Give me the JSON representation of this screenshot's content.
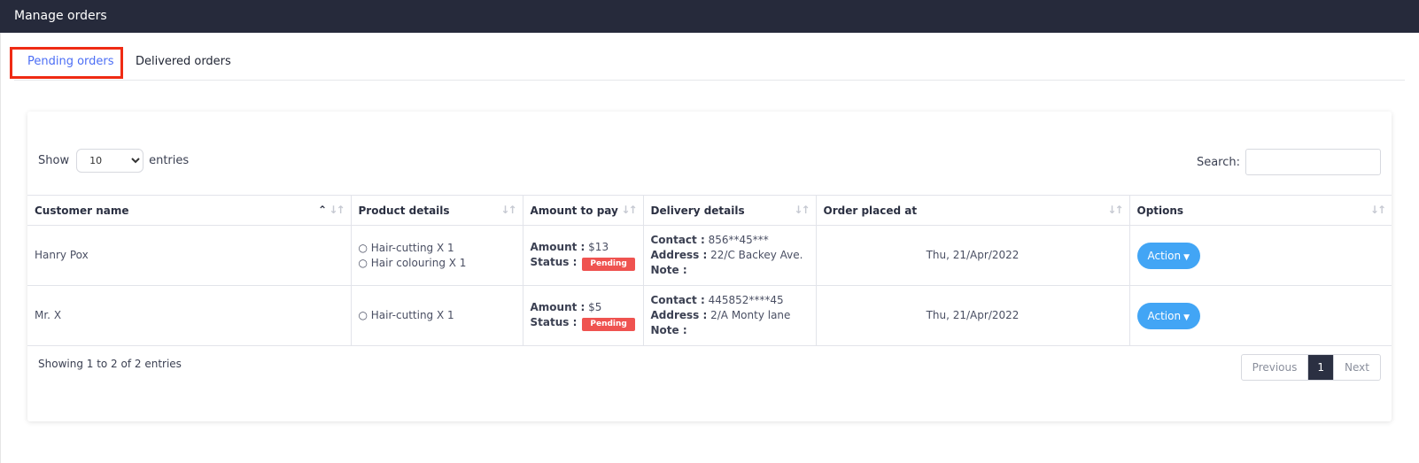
{
  "header": {
    "title": "Manage orders"
  },
  "tabs": [
    {
      "label": "Pending orders",
      "active": true
    },
    {
      "label": "Delivered orders",
      "active": false
    }
  ],
  "controls": {
    "show_label": "Show",
    "entries_label": "entries",
    "page_size": "10",
    "search_label": "Search:",
    "search_value": ""
  },
  "table": {
    "columns": [
      "Customer name",
      "Product details",
      "Amount to pay",
      "Delivery details",
      "Order placed at",
      "Options"
    ],
    "labels": {
      "amount": "Amount :",
      "status": "Status :",
      "contact": "Contact :",
      "address": "Address :",
      "note": "Note :"
    },
    "rows": [
      {
        "customer": "Hanry Pox",
        "products": [
          "○ Hair-cutting X 1",
          "○ Hair colouring X 1"
        ],
        "amount": "$13",
        "status": "Pending",
        "contact": "856**45***",
        "address": "22/C Backey Ave.",
        "note": "",
        "placed_at": "Thu, 21/Apr/2022",
        "action": "Action"
      },
      {
        "customer": "Mr. X",
        "products": [
          "○ Hair-cutting X 1"
        ],
        "amount": "$5",
        "status": "Pending",
        "contact": "445852****45",
        "address": "2/A Monty lane",
        "note": "",
        "placed_at": "Thu, 21/Apr/2022",
        "action": "Action"
      }
    ]
  },
  "footer": {
    "info": "Showing 1 to 2 of 2 entries",
    "previous": "Previous",
    "page": "1",
    "next": "Next"
  },
  "colors": {
    "header_bg": "#262a3b",
    "active_tab": "#4c6ef5",
    "highlight_box": "#ef2b14",
    "status_badge": "#ef5350",
    "action_button": "#42a5f5"
  }
}
